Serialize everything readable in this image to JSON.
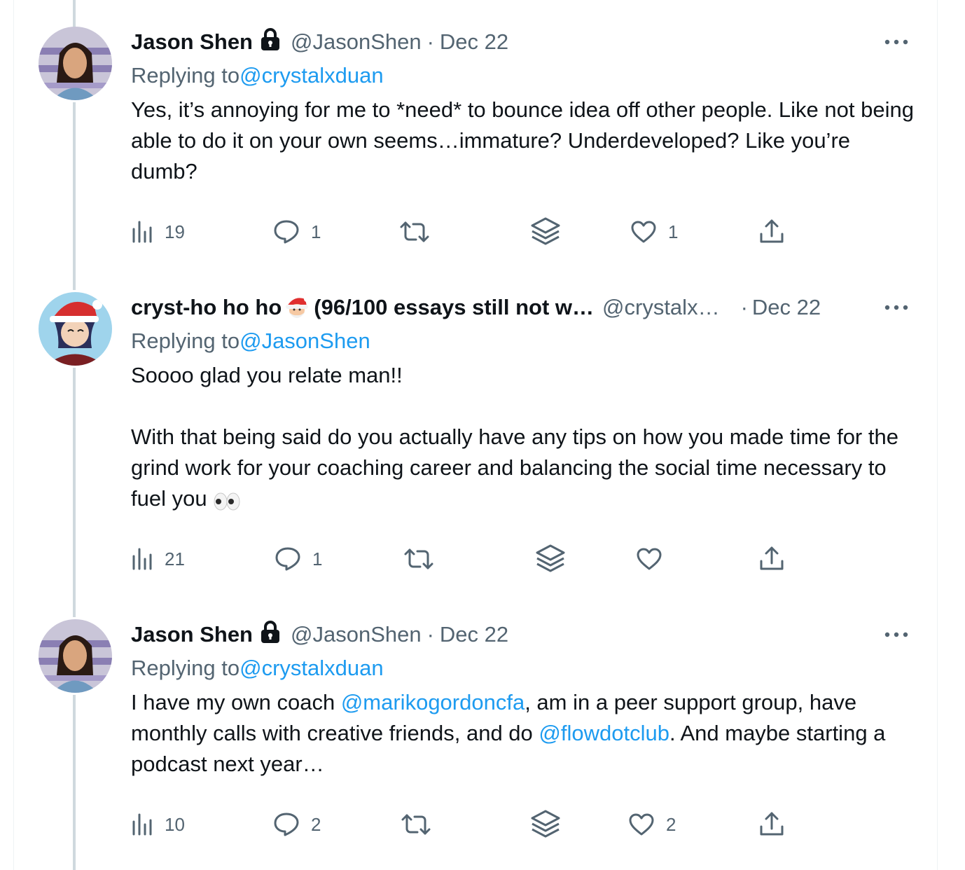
{
  "tweets": [
    {
      "name": "Jason Shen",
      "handle": "@JasonShen",
      "dot": "·",
      "date": "Dec 22",
      "replying_prefix": "Replying to ",
      "replying_to": "@crystalxduan",
      "text": "Yes, it’s annoying for me to *need* to bounce idea off other people. Like not being able to do it on your own seems…immature? Underdeveloped? Like you’re dumb?",
      "views": "19",
      "replies": "1",
      "retweets": "",
      "likes": "1"
    },
    {
      "name_part1": "cryst-ho ho ho",
      "name_part2": " (96/100 essays still not w…",
      "handle": "@crystalx…",
      "dot": "·",
      "date": "Dec 22",
      "replying_prefix": "Replying to ",
      "replying_to": "@JasonShen",
      "text": "Soooo glad you relate man!!\n\nWith that being said do you actually have any tips on how you made time for the grind work for your coaching career and balancing the social time necessary to fuel you",
      "views": "21",
      "replies": "1",
      "retweets": "",
      "likes": ""
    },
    {
      "name": "Jason Shen",
      "handle": "@JasonShen",
      "dot": "·",
      "date": "Dec 22",
      "replying_prefix": "Replying to ",
      "replying_to": "@crystalxduan",
      "text_a": "I have my own coach ",
      "mention_a": "@marikogordoncfa",
      "text_b": ", am in a peer support group, have monthly calls with creative friends, and do ",
      "mention_b": "@flowdotclub",
      "text_c": ". And maybe starting a podcast next year…",
      "views": "10",
      "replies": "2",
      "retweets": "",
      "likes": "2"
    }
  ],
  "icons": [
    "lock-icon",
    "more-icon",
    "views-icon",
    "reply-icon",
    "retweet-icon",
    "stack-icon",
    "like-icon",
    "share-icon",
    "santa-emoji",
    "eyes-emoji"
  ],
  "colors": {
    "text": "#0f1419",
    "secondary": "#536471",
    "accent": "#1d9bf0",
    "thread_line": "#cfd9de"
  }
}
